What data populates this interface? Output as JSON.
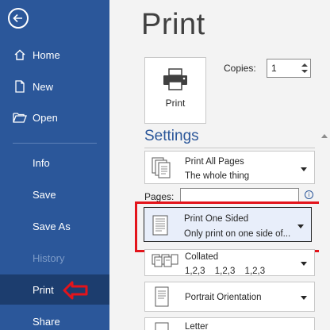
{
  "sidebar": {
    "items": [
      {
        "label": "Home"
      },
      {
        "label": "New"
      },
      {
        "label": "Open"
      },
      {
        "label": "Info"
      },
      {
        "label": "Save"
      },
      {
        "label": "Save As"
      },
      {
        "label": "History"
      },
      {
        "label": "Print"
      },
      {
        "label": "Share"
      }
    ],
    "active": "Print"
  },
  "main": {
    "title": "Print",
    "print_button_label": "Print",
    "copies_label": "Copies:",
    "copies_value": "1",
    "settings_heading": "Settings",
    "pages_label": "Pages:",
    "pages_value": "",
    "info_glyph": "i",
    "dropdowns": {
      "pages": {
        "line1": "Print All Pages",
        "line2": "The whole thing"
      },
      "sided": {
        "line1": "Print One Sided",
        "line2": "Only print on one side of..."
      },
      "collated": {
        "line1": "Collated",
        "line2": "1,2,3 1,2,3 1,2,3"
      },
      "orientation": {
        "line1": "Portrait Orientation"
      },
      "paper": {
        "line1": "Letter"
      }
    }
  },
  "colors": {
    "sidebar_bg": "#2b579a",
    "sidebar_active": "#1c3d6e",
    "accent": "#2b579a",
    "highlight": "#e3141b"
  }
}
